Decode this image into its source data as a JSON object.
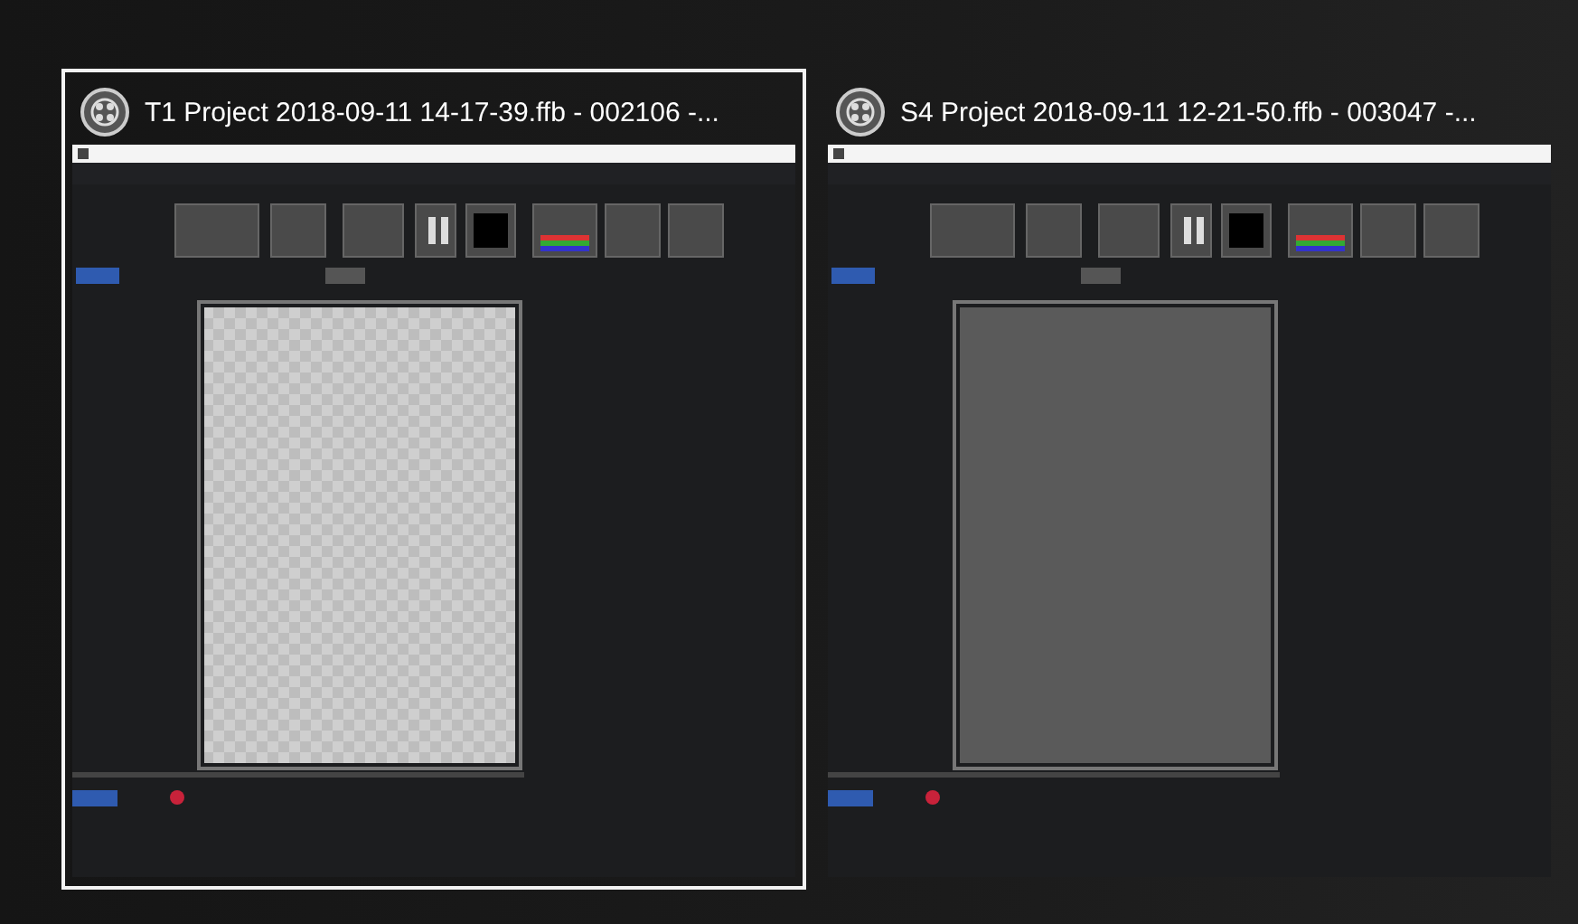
{
  "windows": [
    {
      "title": "T1 Project 2018-09-11 14-17-39.ffb - 002106 -...",
      "selected": true,
      "transparent_canvas": true
    },
    {
      "title": "S4 Project 2018-09-11 12-21-50.ffb - 003047 -...",
      "selected": false,
      "transparent_canvas": false
    }
  ]
}
